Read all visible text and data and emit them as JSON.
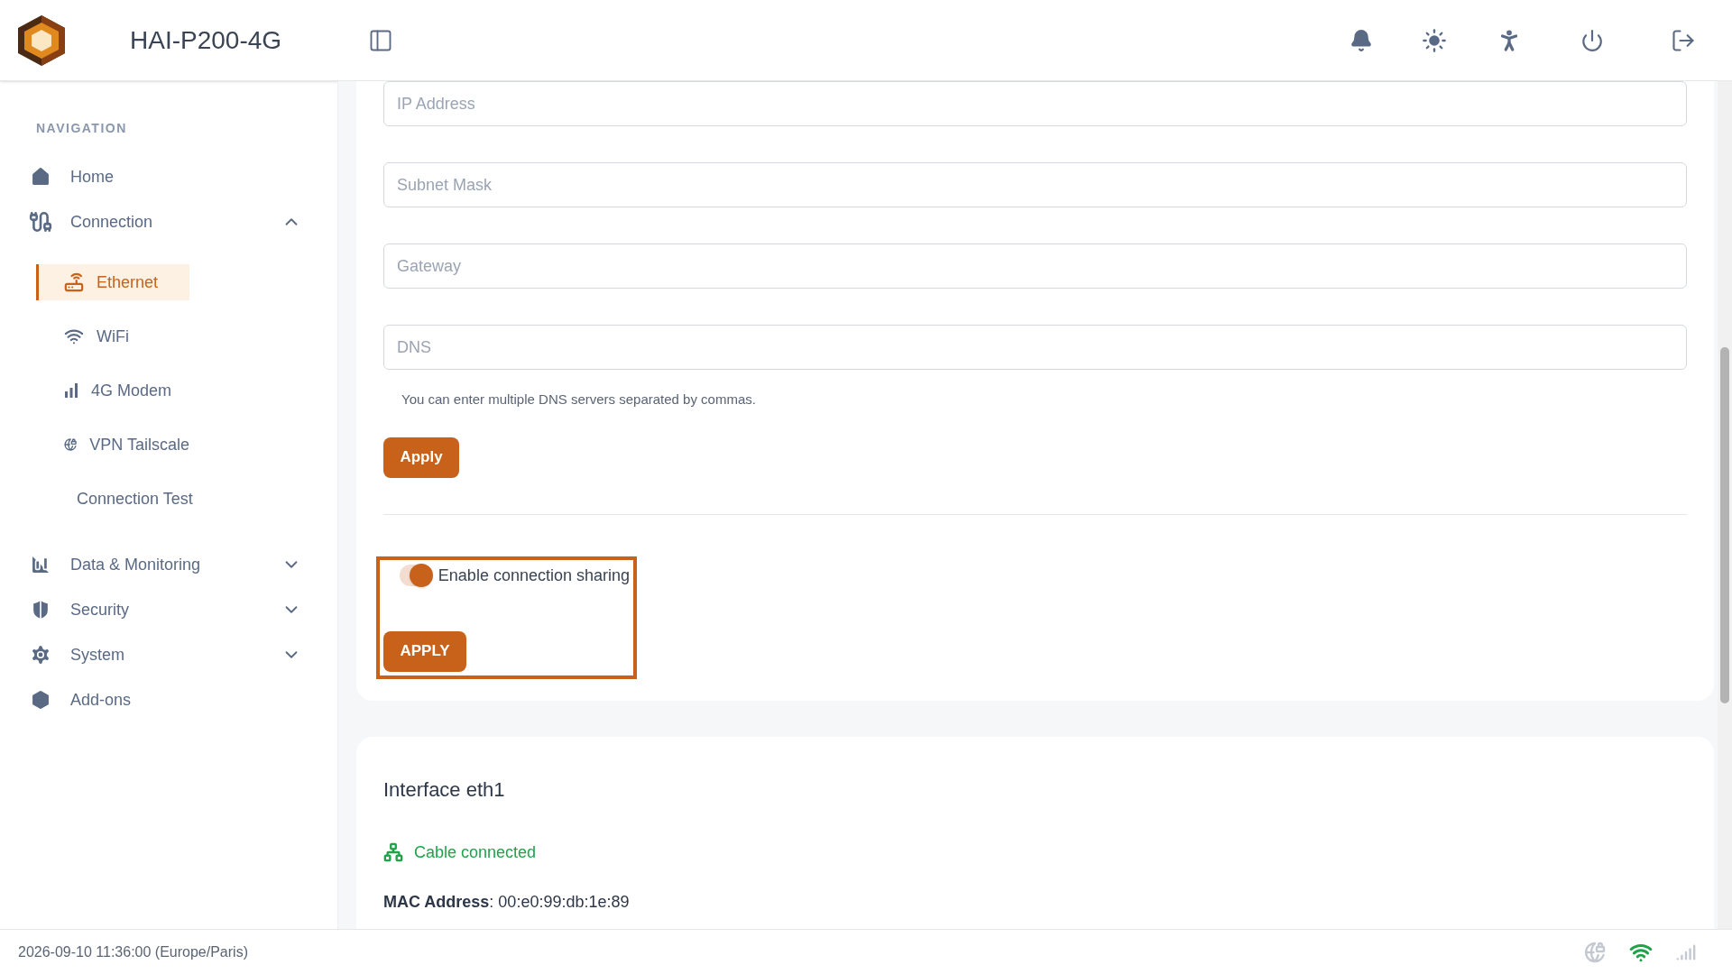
{
  "header": {
    "title": "HAI-P200-4G"
  },
  "sidebar": {
    "heading": "NAVIGATION",
    "items": [
      {
        "label": "Home",
        "selected": false
      },
      {
        "label": "Connection",
        "expanded": true,
        "selected": false,
        "children": [
          {
            "label": "Ethernet",
            "selected": true
          },
          {
            "label": "WiFi",
            "selected": false
          },
          {
            "label": "4G Modem",
            "selected": false
          },
          {
            "label": "VPN Tailscale",
            "selected": false
          },
          {
            "label": "Connection Test",
            "selected": false
          }
        ]
      },
      {
        "label": "Data & Monitoring",
        "expanded": false,
        "selected": false
      },
      {
        "label": "Security",
        "expanded": false,
        "selected": false
      },
      {
        "label": "System",
        "expanded": false,
        "selected": false
      },
      {
        "label": "Add-ons",
        "selected": false
      }
    ]
  },
  "form": {
    "fields": [
      {
        "placeholder": "IP Address"
      },
      {
        "placeholder": "Subnet Mask"
      },
      {
        "placeholder": "Gateway"
      },
      {
        "placeholder": "DNS"
      }
    ],
    "hint": "You can enter multiple DNS servers separated by commas.",
    "apply": "Apply",
    "sharing": {
      "label": "Enable connection sharing",
      "on": true,
      "button": "APPLY"
    }
  },
  "interface": {
    "title": "Interface eth1",
    "status": "Cable connected",
    "mac": "**MAC Address**: 00:e0:99:db:1e:89"
  },
  "status_bar": {
    "datetime": "2026-09-10 11:36:00 (Europe/Paris)"
  }
}
